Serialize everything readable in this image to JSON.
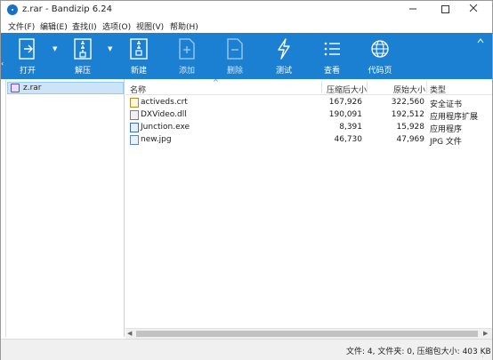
{
  "window": {
    "title": "z.rar - Bandizip 6.24"
  },
  "menu": [
    "文件(F)",
    "编辑(E)",
    "查找(I)",
    "选项(O)",
    "视图(V)",
    "帮助(H)"
  ],
  "toolbar": {
    "open": "打开",
    "extract": "解压",
    "new": "新建",
    "add": "添加",
    "delete": "删除",
    "test": "测试",
    "view": "查看",
    "codepage": "代码页"
  },
  "tree": {
    "item": "z.rar"
  },
  "columns": {
    "name": "名称",
    "compressed": "压缩后大小",
    "original": "原始大小",
    "type": "类型"
  },
  "files": [
    {
      "name": "activeds.crt",
      "compressed": "167,926",
      "original": "322,560",
      "type": "安全证书",
      "icon": "certificate-icon"
    },
    {
      "name": "DXVideo.dll",
      "compressed": "190,091",
      "original": "192,512",
      "type": "应用程序扩展",
      "icon": "dll-file-icon"
    },
    {
      "name": "Junction.exe",
      "compressed": "8,391",
      "original": "15,928",
      "type": "应用程序",
      "icon": "exe-file-icon"
    },
    {
      "name": "new.jpg",
      "compressed": "46,730",
      "original": "47,969",
      "type": "JPG 文件",
      "icon": "image-file-icon"
    }
  ],
  "status": {
    "text": "文件: 4, 文件夹: 0, 压缩包大小: 403 KB"
  },
  "colors": {
    "toolbar": "#1c80d2",
    "selection": "#cce4f7"
  }
}
